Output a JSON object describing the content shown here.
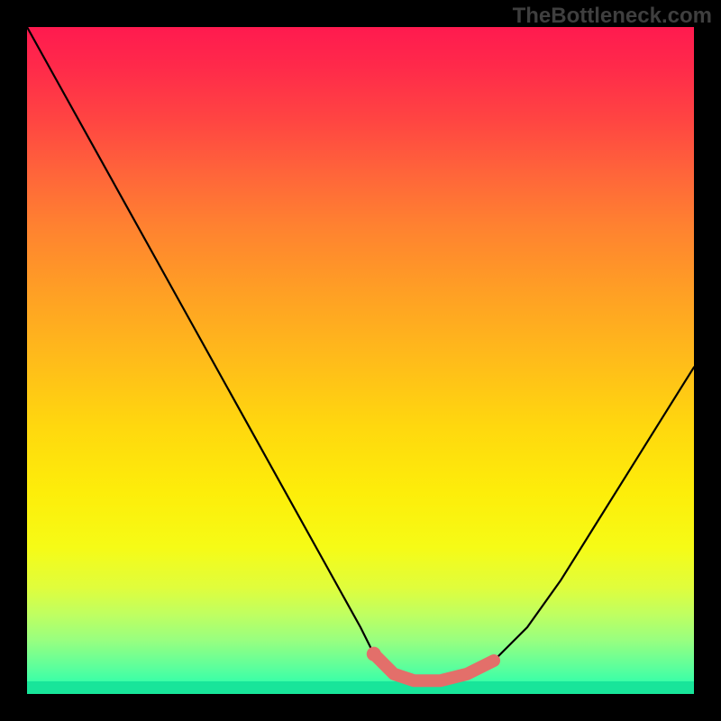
{
  "watermark": "TheBottleneck.com",
  "chart_data": {
    "type": "line",
    "title": "",
    "xlabel": "",
    "ylabel": "",
    "xlim": [
      0,
      100
    ],
    "ylim": [
      0,
      100
    ],
    "series": [
      {
        "name": "bottleneck-curve",
        "x": [
          0,
          5,
          10,
          15,
          20,
          25,
          30,
          35,
          40,
          45,
          50,
          52,
          55,
          58,
          62,
          66,
          70,
          75,
          80,
          85,
          90,
          95,
          100
        ],
        "values": [
          100,
          91,
          82,
          73,
          64,
          55,
          46,
          37,
          28,
          19,
          10,
          6,
          3,
          2,
          2,
          3,
          5,
          10,
          17,
          25,
          33,
          41,
          49
        ]
      }
    ],
    "highlight": {
      "name": "optimal-range",
      "x": [
        52,
        55,
        58,
        62,
        66,
        70
      ],
      "values": [
        6,
        3,
        2,
        2,
        3,
        5
      ]
    },
    "background": {
      "type": "vertical-gradient",
      "stops": [
        {
          "pos": 0.0,
          "color": "#ff1a4f"
        },
        {
          "pos": 0.5,
          "color": "#ffd80e"
        },
        {
          "pos": 0.85,
          "color": "#d8fe48"
        },
        {
          "pos": 1.0,
          "color": "#1effb0"
        }
      ]
    }
  }
}
